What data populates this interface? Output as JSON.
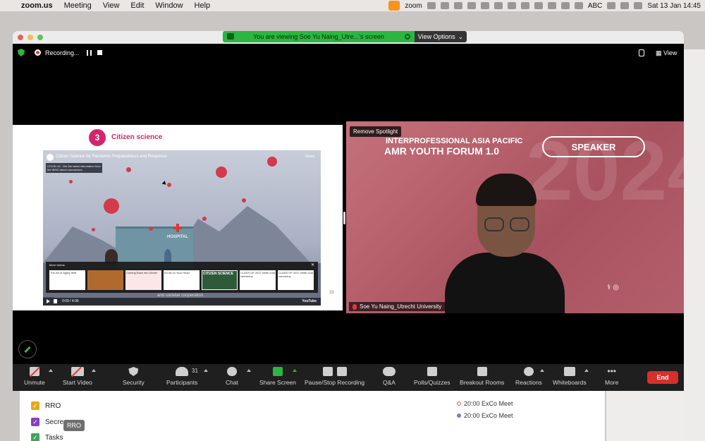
{
  "menubar": {
    "app": "zoom.us",
    "items": [
      "Meeting",
      "View",
      "Edit",
      "Window",
      "Help"
    ],
    "zoom_label": "zoom",
    "abc": "ABC",
    "datetime": "Sat 13 Jan  14:45"
  },
  "background_calendar": {
    "rows": [
      {
        "label": "RRO",
        "color": "#e6a817"
      },
      {
        "label": "Secre",
        "color": "#8b3fbf"
      },
      {
        "label": "Tasks",
        "color": "#3aa655"
      }
    ],
    "events": [
      "20:00 ExCo Meet",
      "20:00 ExCo Meet"
    ],
    "tooltip": "RRO"
  },
  "zoom_window": {
    "share_banner": "You are viewing Soe Yu Naing_Utre...'s screen",
    "view_options": "View Options",
    "recording_label": "Recording...",
    "view_label": "View"
  },
  "slide": {
    "number": "3",
    "title": "Citizen science",
    "page_number": "33",
    "video": {
      "title": "Citizen Science for Pandemic Preparedness and Response",
      "covid_note": "COVID-19 - Get the latest information from the WHO about coronavirus.",
      "share": "Share",
      "hospital": "HOSPITAL",
      "more_videos": "More videos",
      "thumbs": [
        "The Art of Aging Well",
        "",
        "Coming Back Into Dinner",
        "It's All on Your Head",
        "CITIZEN SCIENCE",
        "CLASS OF 2027 white coat ceremony",
        "CLASS OF 2027 white coat ceremony"
      ],
      "caption": "and societal cooperation",
      "time": "0:09 / 4:06",
      "youtube": "YouTube",
      "progress": 0.04
    }
  },
  "speaker_panel": {
    "remove_spotlight": "Remove Spotlight",
    "forum_line1": "INTERPROFESSIONAL ASIA PACIFIC",
    "forum_line2": "AMR YOUTH FORUM 1.0",
    "speaker_badge": "SPEAKER",
    "bg_year": "2024",
    "name_tag": "Soe Yu Naing_Utrecht University"
  },
  "toolbar": {
    "unmute": "Unmute",
    "start_video": "Start Video",
    "security": "Security",
    "participants": "Participants",
    "participants_count": "31",
    "chat": "Chat",
    "share_screen": "Share Screen",
    "pause_stop": "Pause/Stop Recording",
    "qa": "Q&A",
    "polls": "Polls/Quizzes",
    "breakout": "Breakout Rooms",
    "reactions": "Reactions",
    "whiteboards": "Whiteboards",
    "more": "More",
    "end": "End"
  },
  "colors": {
    "accent_green": "#2ab640",
    "slide_pink": "#d5246c",
    "end_red": "#d6302d",
    "toolbar_bg": "#1f1f1f"
  }
}
